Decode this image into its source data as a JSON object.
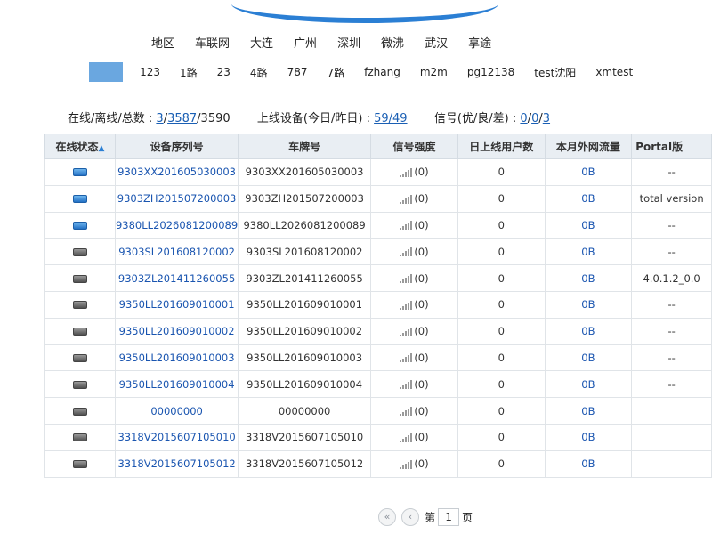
{
  "regions": [
    "地区",
    "车联网",
    "大连",
    "广州",
    "深圳",
    "微沸",
    "武汉",
    "享途"
  ],
  "groups": [
    "123",
    "1路",
    "23",
    "4路",
    "787",
    "7路",
    "fzhang",
    "m2m",
    "pg12138",
    "test沈阳",
    "xmtest"
  ],
  "stats": {
    "online_label": "在线/离线/总数 : ",
    "online": "3",
    "sep1": "/",
    "offline": "3587",
    "sep2": "/3590",
    "devices_label": "上线设备(今日/昨日) : ",
    "today_yesterday": "59/49",
    "signal_label": "信号(优/良/差) : ",
    "sig_good": "0",
    "sig_slash1": "/",
    "sig_fair": "0",
    "sig_slash2": "/",
    "sig_poor": "3"
  },
  "table": {
    "headers": [
      "在线状态",
      "设备序列号",
      "车牌号",
      "信号强度",
      "日上线用户数",
      "本月外网流量",
      "Portal版"
    ],
    "rows": [
      {
        "status": "online",
        "serial": "9303XX201605030003",
        "plate": "9303XX201605030003",
        "signal": "(0)",
        "users": "0",
        "traffic": "0B",
        "portal": "--"
      },
      {
        "status": "online",
        "serial": "9303ZH201507200003",
        "plate": "9303ZH201507200003",
        "signal": "(0)",
        "users": "0",
        "traffic": "0B",
        "portal": "total version"
      },
      {
        "status": "online",
        "serial": "9380LL2026081200089",
        "plate": "9380LL2026081200089",
        "signal": "(0)",
        "users": "0",
        "traffic": "0B",
        "portal": "--"
      },
      {
        "status": "offline",
        "serial": "9303SL201608120002",
        "plate": "9303SL201608120002",
        "signal": "(0)",
        "users": "0",
        "traffic": "0B",
        "portal": "--"
      },
      {
        "status": "offline",
        "serial": "9303ZL201411260055",
        "plate": "9303ZL201411260055",
        "signal": "(0)",
        "users": "0",
        "traffic": "0B",
        "portal": "4.0.1.2_0.0"
      },
      {
        "status": "offline",
        "serial": "9350LL201609010001",
        "plate": "9350LL201609010001",
        "signal": "(0)",
        "users": "0",
        "traffic": "0B",
        "portal": "--"
      },
      {
        "status": "offline",
        "serial": "9350LL201609010002",
        "plate": "9350LL201609010002",
        "signal": "(0)",
        "users": "0",
        "traffic": "0B",
        "portal": "--"
      },
      {
        "status": "offline",
        "serial": "9350LL201609010003",
        "plate": "9350LL201609010003",
        "signal": "(0)",
        "users": "0",
        "traffic": "0B",
        "portal": "--"
      },
      {
        "status": "offline",
        "serial": "9350LL201609010004",
        "plate": "9350LL201609010004",
        "signal": "(0)",
        "users": "0",
        "traffic": "0B",
        "portal": "--"
      },
      {
        "status": "offline",
        "serial": "00000000",
        "plate": "00000000",
        "signal": "(0)",
        "users": "0",
        "traffic": "0B",
        "portal": ""
      },
      {
        "status": "offline",
        "serial": "3318V2015607105010",
        "plate": "3318V2015607105010",
        "signal": "(0)",
        "users": "0",
        "traffic": "0B",
        "portal": ""
      },
      {
        "status": "offline",
        "serial": "3318V2015607105012",
        "plate": "3318V2015607105012",
        "signal": "(0)",
        "users": "0",
        "traffic": "0B",
        "portal": ""
      }
    ]
  },
  "pager": {
    "first_icon": "double-chevron-left-icon",
    "prev_icon": "chevron-left-icon",
    "page_prefix": "第",
    "page_value": "1",
    "page_suffix": "页"
  },
  "colors": {
    "accent": "#2b7fd4",
    "link": "#1a55b0",
    "header_bg": "#e9eef3",
    "selected_tab": "#6aa7e0"
  }
}
